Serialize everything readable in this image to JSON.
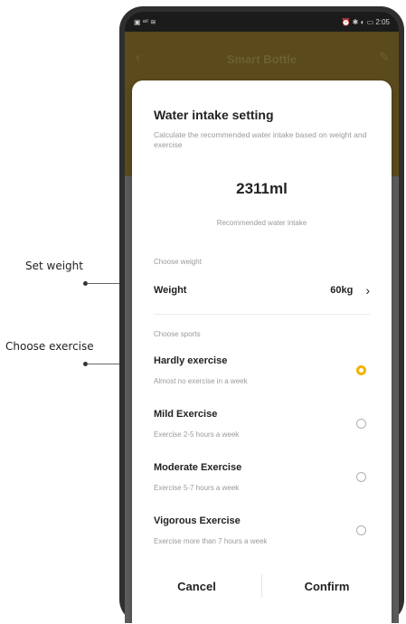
{
  "annotations": {
    "set_weight": "Set weight",
    "choose_exercise": "Choose exercise"
  },
  "status_bar": {
    "left_icons": "▣ ᵃᵗˡ ≋",
    "right_text": "⏰ ✱ ◐ ▭ 2:05"
  },
  "app_bar": {
    "title": "Smart Bottle",
    "back_icon": "back-arrow-icon",
    "edit_icon": "pencil-icon"
  },
  "dialog": {
    "title": "Water intake setting",
    "description": "Calculate the recommended water intake based on weight and exercise",
    "amount": "2311ml",
    "amount_label": "Recommended water intake",
    "weight_section_label": "Choose weight",
    "weight_label": "Weight",
    "weight_value": "60kg",
    "sports_section_label": "Choose sports",
    "options": [
      {
        "name": "Hardly exercise",
        "sub": "Almost no exercise in a week",
        "selected": true
      },
      {
        "name": "Mild Exercise",
        "sub": "Exercise 2-5 hours a week",
        "selected": false
      },
      {
        "name": "Moderate Exercise",
        "sub": "Exercise 5-7 hours a week",
        "selected": false
      },
      {
        "name": "Vigorous Exercise",
        "sub": "Exercise more than 7 hours a week",
        "selected": false
      }
    ],
    "cancel_label": "Cancel",
    "confirm_label": "Confirm"
  },
  "colors": {
    "accent": "#f0b400",
    "app_bar": "#5a4a1c"
  }
}
